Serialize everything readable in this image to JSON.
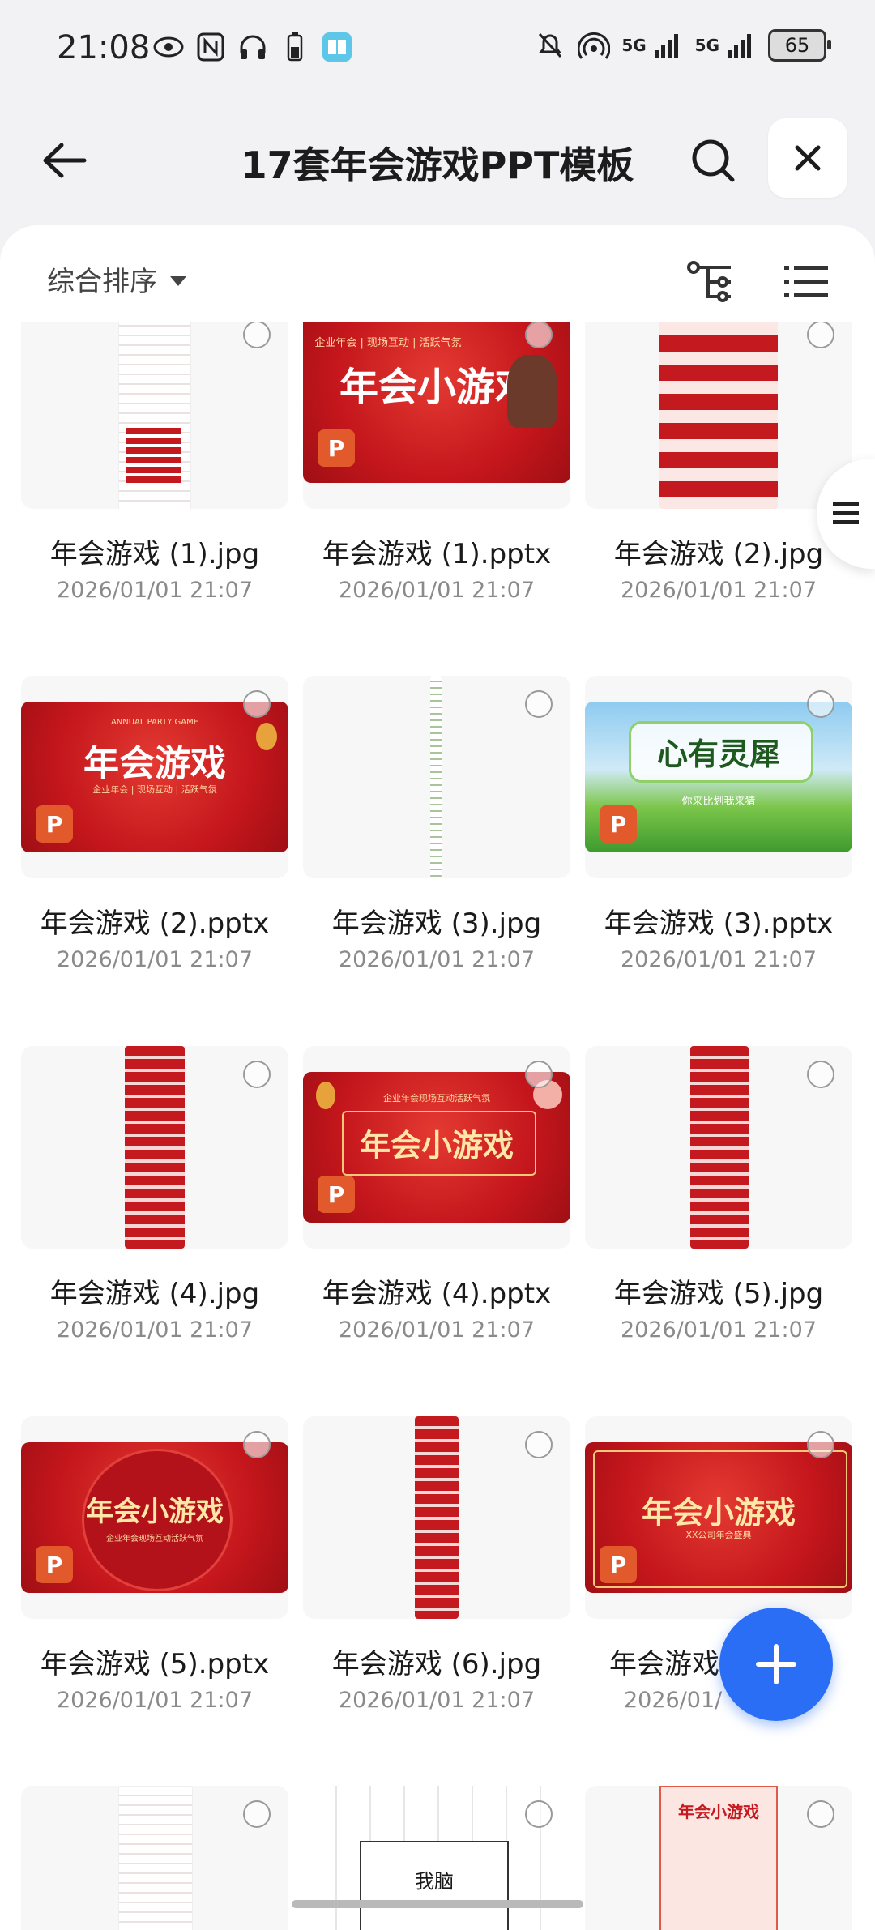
{
  "status_bar": {
    "time": "21:08",
    "signal1": "5G",
    "signal2": "5G",
    "battery": "65"
  },
  "header": {
    "title": "17套年会游戏PPT模板"
  },
  "sort": {
    "label": "综合排序"
  },
  "files": [
    {
      "name": "年会游戏 (1).jpg",
      "date": "2026/01/01 21:07"
    },
    {
      "name": "年会游戏 (1).pptx",
      "date": "2026/01/01 21:07",
      "thumb_title": "年会小游戏",
      "thumb_sub": "企业年会 | 现场互动 | 活跃气氛",
      "badge": "P"
    },
    {
      "name": "年会游戏 (2).jpg",
      "date": "2026/01/01 21:07"
    },
    {
      "name": "年会游戏 (2).pptx",
      "date": "2026/01/01 21:07",
      "thumb_top": "ANNUAL PARTY GAME",
      "thumb_title": "年会游戏",
      "thumb_sub": "企业年会 | 现场互动 | 活跃气氛",
      "badge": "P"
    },
    {
      "name": "年会游戏 (3).jpg",
      "date": "2026/01/01 21:07"
    },
    {
      "name": "年会游戏 (3).pptx",
      "date": "2026/01/01 21:07",
      "thumb_title": "心有灵犀",
      "thumb_sub": "你来比划我来猜",
      "badge": "P"
    },
    {
      "name": "年会游戏 (4).jpg",
      "date": "2026/01/01 21:07"
    },
    {
      "name": "年会游戏 (4).pptx",
      "date": "2026/01/01 21:07",
      "thumb_sub": "企业年会现场互动活跃气氛",
      "thumb_title": "年会小游戏",
      "badge": "P"
    },
    {
      "name": "年会游戏 (5).jpg",
      "date": "2026/01/01 21:07"
    },
    {
      "name": "年会游戏 (5).pptx",
      "date": "2026/01/01 21:07",
      "thumb_title": "年会小游戏",
      "thumb_sub": "企业年会现场互动活跃气氛",
      "badge": "P"
    },
    {
      "name": "年会游戏 (6).jpg",
      "date": "2026/01/01 21:07"
    },
    {
      "name": "年会游戏",
      "date": "2026/01/",
      "thumb_title": "年会小游戏",
      "thumb_sub": "XX公司年会盛典",
      "badge": "P"
    }
  ],
  "partial_row": {
    "thumb1_text": "我脑",
    "thumb3_title": "年会小游戏"
  },
  "colors": {
    "accent": "#2a6ef5",
    "ppt_badge": "#e2592c",
    "festive_red": "#c4161c",
    "gold": "#ffe7a8"
  },
  "icons": [
    "back-arrow-icon",
    "search-icon",
    "close-icon",
    "sort-caret-icon",
    "tree-view-icon",
    "list-view-icon",
    "plus-icon",
    "menu-icon"
  ]
}
